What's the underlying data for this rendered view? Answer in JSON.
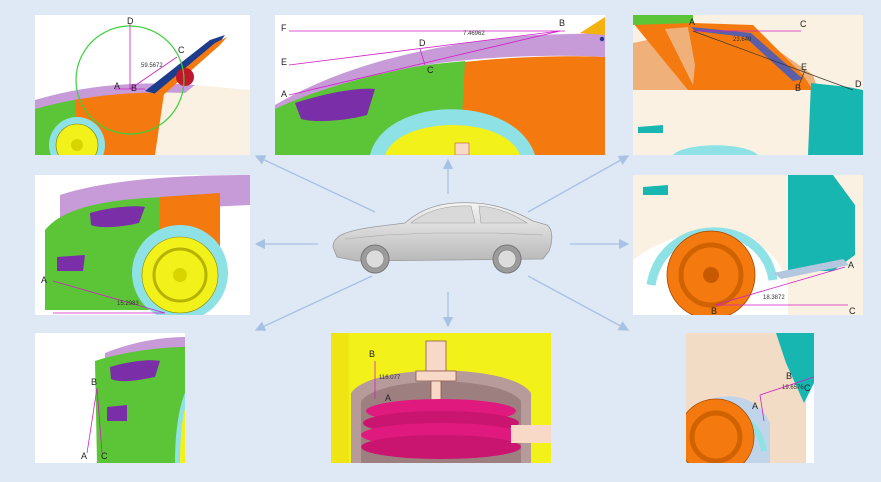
{
  "panels": {
    "top_left": {
      "labels": [
        "D",
        "C",
        "A",
        "B"
      ],
      "value": "59.5672"
    },
    "top_center": {
      "labels": [
        "F",
        "B",
        "E",
        "D",
        "C",
        "A"
      ],
      "value": "7.46962"
    },
    "top_right": {
      "labels": [
        "A",
        "C",
        "E",
        "D",
        "B"
      ],
      "value": "23.649"
    },
    "mid_left": {
      "labels": [
        "A"
      ],
      "value": "15.2983"
    },
    "mid_right": {
      "labels": [
        "A",
        "B",
        "C"
      ],
      "value": "18.3872"
    },
    "bottom_left": {
      "labels": [
        "B",
        "A",
        "C"
      ]
    },
    "bottom_center": {
      "labels": [
        "B",
        "A"
      ],
      "value": "116.077"
    },
    "bottom_right": {
      "labels": [
        "B",
        "A",
        "C"
      ],
      "value": "19.6576"
    }
  },
  "colors": {
    "background": "#dfe8f5",
    "arrow": "#a9c2e3",
    "green": "#5cc437",
    "orange": "#f47a0f",
    "purple": "#7a2ea8",
    "lavender": "#c79ad8",
    "yellow": "#f3f11a",
    "cyan": "#8ee2e6",
    "teal": "#18b6b0",
    "cream": "#fbf1e2",
    "magenta": "#e0197e",
    "measure": "#d21ec8"
  }
}
